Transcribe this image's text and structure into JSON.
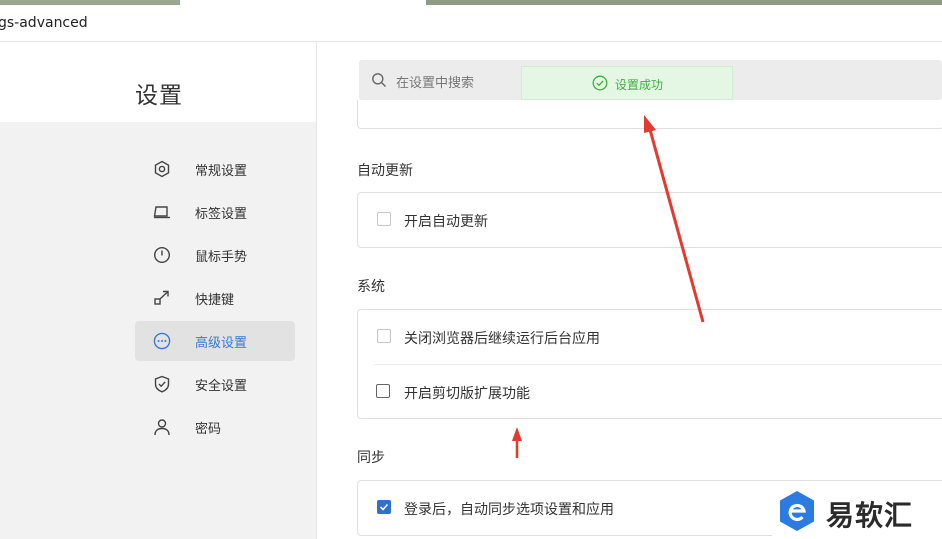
{
  "browser": {
    "url_fragment": "gs-advanced"
  },
  "sidebar": {
    "title": "设置",
    "items": [
      {
        "label": "常规设置",
        "icon": "hexagon-settings-icon",
        "active": false
      },
      {
        "label": "标签设置",
        "icon": "tab-icon",
        "active": false
      },
      {
        "label": "鼠标手势",
        "icon": "mouse-icon",
        "active": false
      },
      {
        "label": "快捷键",
        "icon": "shortcut-arrow-icon",
        "active": false
      },
      {
        "label": "高级设置",
        "icon": "more-circle-icon",
        "active": true
      },
      {
        "label": "安全设置",
        "icon": "shield-icon",
        "active": false
      },
      {
        "label": "密码",
        "icon": "user-icon",
        "active": false
      }
    ]
  },
  "search": {
    "placeholder": "在设置中搜索"
  },
  "toast": {
    "text": "设置成功",
    "color": "#3eb13e"
  },
  "sections": {
    "auto_update": {
      "title": "自动更新",
      "options": [
        {
          "label": "开启自动更新",
          "checked": false
        }
      ]
    },
    "system": {
      "title": "系统",
      "options": [
        {
          "label": "关闭浏览器后继续运行后台应用",
          "checked": false
        },
        {
          "label": "开启剪切版扩展功能",
          "checked": false
        }
      ]
    },
    "sync": {
      "title": "同步",
      "options": [
        {
          "label": "登录后，自动同步选项设置和应用",
          "checked": true
        }
      ]
    }
  },
  "watermark": {
    "text": "易软汇"
  },
  "colors": {
    "accent": "#2f6fd0",
    "annotation_arrow": "#e23a2e",
    "toast_bg": "#e4f6e4"
  }
}
